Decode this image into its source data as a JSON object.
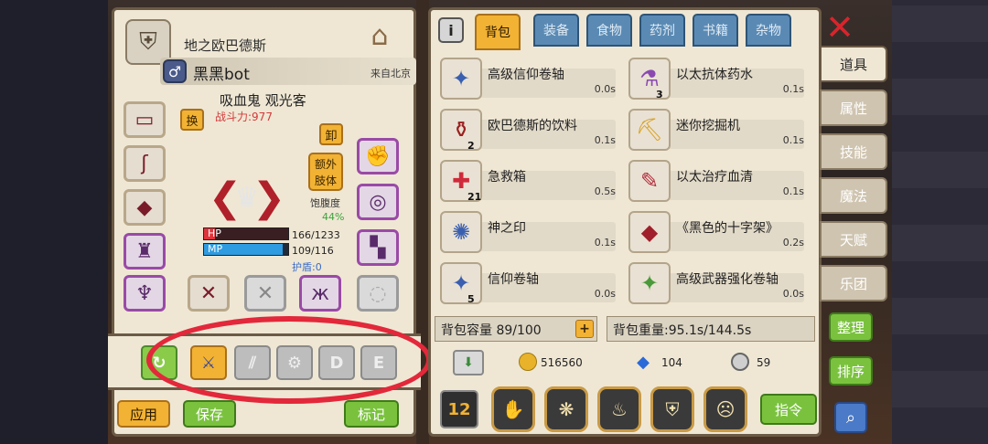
{
  "character": {
    "realm": "地之欧巴德斯",
    "player_name": "黑黑bot",
    "origin": "来自北京",
    "title": "吸血鬼 观光客",
    "power": "战斗力:977",
    "swap_label": "换",
    "unequip_label": "卸",
    "extra_limb_label": "额外肢体",
    "hunger_label": "饱腹度",
    "hunger_value": "44%",
    "hp_label": "HP",
    "hp_value": "166/1233",
    "hp_fraction": 0.135,
    "mp_label": "MP",
    "mp_value": "109/116",
    "mp_fraction": 0.94,
    "shield": "护盾:0"
  },
  "skills": [
    "D",
    "E"
  ],
  "bottom_buttons": {
    "apply": "应用",
    "save": "保存",
    "mark": "标记"
  },
  "tabs": [
    "背包",
    "装备",
    "食物",
    "药剂",
    "书籍",
    "杂物"
  ],
  "items": [
    {
      "name": "高级信仰卷轴",
      "weight": "0.0s",
      "qty": "",
      "icon": "scroll-icon"
    },
    {
      "name": "以太抗体药水",
      "weight": "0.1s",
      "qty": "3",
      "icon": "potion-icon"
    },
    {
      "name": "欧巴德斯的饮料",
      "weight": "0.1s",
      "qty": "2",
      "icon": "drink-icon"
    },
    {
      "name": "迷你挖掘机",
      "weight": "0.1s",
      "qty": "",
      "icon": "excavator-icon"
    },
    {
      "name": "急救箱",
      "weight": "0.5s",
      "qty": "21",
      "icon": "first-aid-icon"
    },
    {
      "name": "以太治疗血清",
      "weight": "0.1s",
      "qty": "",
      "icon": "syringe-icon"
    },
    {
      "name": "神之印",
      "weight": "0.1s",
      "qty": "",
      "icon": "seal-icon"
    },
    {
      "name": "《黑色的十字架》",
      "weight": "0.2s",
      "qty": "",
      "icon": "book-icon"
    },
    {
      "name": "信仰卷轴",
      "weight": "0.0s",
      "qty": "5",
      "icon": "scroll-icon"
    },
    {
      "name": "高级武器强化卷轴",
      "weight": "0.0s",
      "qty": "",
      "icon": "enhance-scroll-icon"
    }
  ],
  "capacity": "背包容量 89/100",
  "weight": "背包重量:95.1s/144.5s",
  "currency": {
    "gold": "516560",
    "gems": "104",
    "tokens": "59"
  },
  "action_row": {
    "number_label": "12",
    "command": "指令"
  },
  "side_tabs": [
    "道具",
    "属性",
    "技能",
    "魔法",
    "天赋",
    "乐团"
  ],
  "side_buttons": {
    "organize": "整理",
    "sort": "排序"
  }
}
